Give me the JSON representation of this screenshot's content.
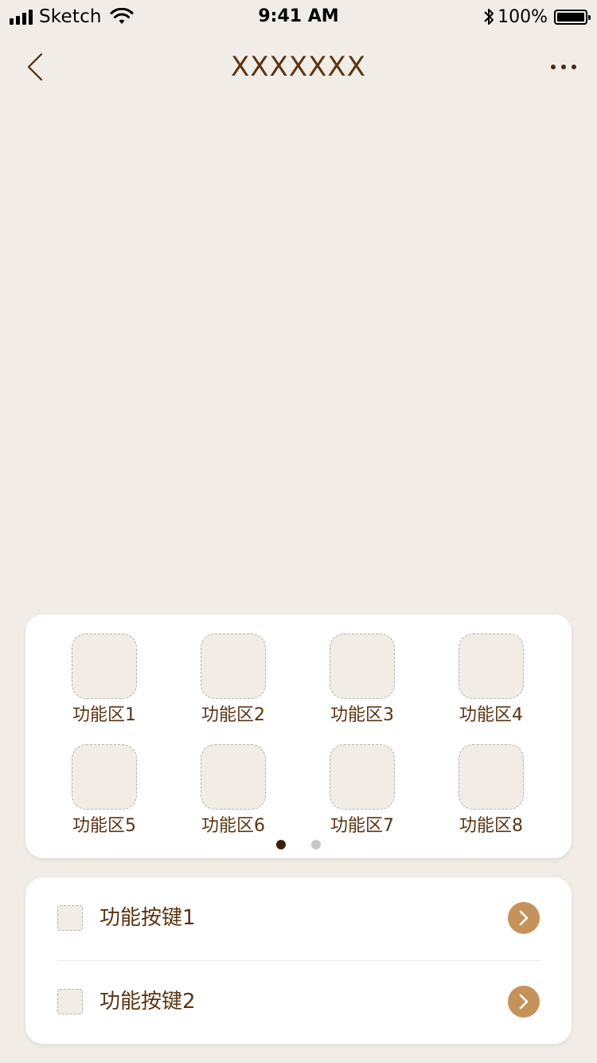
{
  "status_bar": {
    "carrier": "Sketch",
    "time": "9:41 AM",
    "battery_percent": "100%",
    "battery_level": 1.0,
    "icons": [
      "signal-icon",
      "wifi-icon",
      "bluetooth-icon",
      "battery-icon"
    ]
  },
  "nav": {
    "title": "XXXXXXX",
    "back_icon": "chevron-left-icon",
    "more_icon": "more-dots-icon"
  },
  "function_grid": {
    "items": [
      {
        "label": "功能区1"
      },
      {
        "label": "功能区2"
      },
      {
        "label": "功能区3"
      },
      {
        "label": "功能区4"
      },
      {
        "label": "功能区5"
      },
      {
        "label": "功能区6"
      },
      {
        "label": "功能区7"
      },
      {
        "label": "功能区8"
      }
    ],
    "page_count": 2,
    "active_page": 1
  },
  "function_buttons": [
    {
      "label": "功能按键1",
      "arrow_icon": "chevron-right-icon"
    },
    {
      "label": "功能按键2",
      "arrow_icon": "chevron-right-icon"
    }
  ],
  "colors": {
    "background": "#f1ece6",
    "title_text": "#5a3412",
    "accent": "#c4925a",
    "dot_active": "#3d1f08",
    "dot_inactive": "#c8c8c8",
    "card": "#ffffff"
  }
}
